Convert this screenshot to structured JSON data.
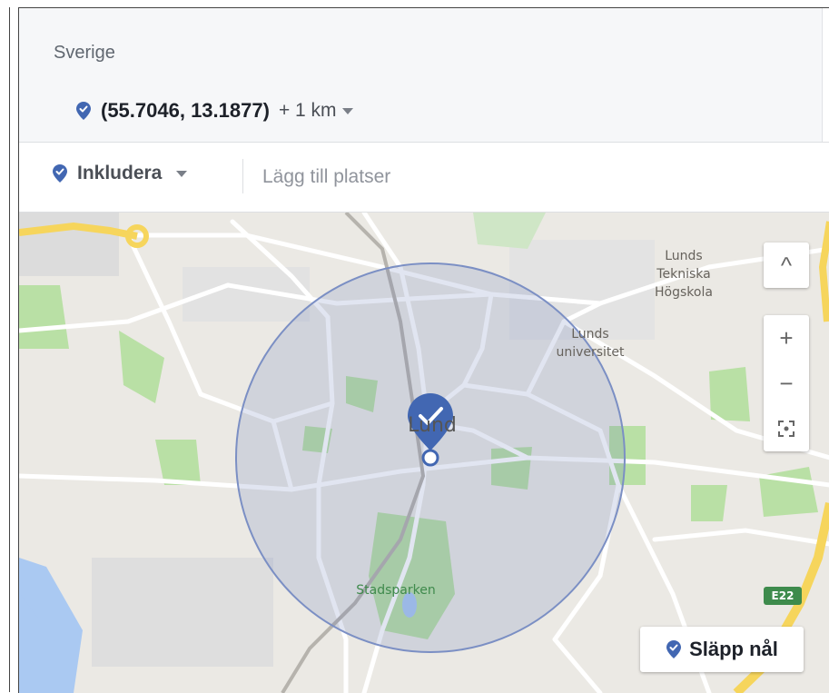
{
  "header": {
    "country": "Sverige",
    "location_coords": "(55.7046, 13.1877)",
    "radius_label": "+ 1 km"
  },
  "include_bar": {
    "include_label": "Inkludera",
    "add_places_placeholder": "Lägg till platser"
  },
  "map": {
    "labels": {
      "lth": [
        "Lunds",
        "Tekniska",
        "Högskola"
      ],
      "university": [
        "Lunds",
        "universitet"
      ],
      "city": "Lund",
      "park": "Stadsparken",
      "road_shield": "E22"
    },
    "controls": {
      "collapse": "^",
      "zoom_in": "+",
      "zoom_out": "−"
    },
    "drop_pin_label": "Släpp nål"
  },
  "colors": {
    "pin": "#4267b2",
    "radius_fill": "rgba(90,110,180,0.18)",
    "radius_stroke": "#7b8fc4",
    "park_green": "#b9e0a5",
    "highway_yellow": "#f6d55c"
  },
  "icons": {
    "location_pin": "location-pin-icon",
    "caret": "caret-down-icon",
    "expand": "chevron-up-icon",
    "fullscreen": "fullscreen-icon"
  }
}
